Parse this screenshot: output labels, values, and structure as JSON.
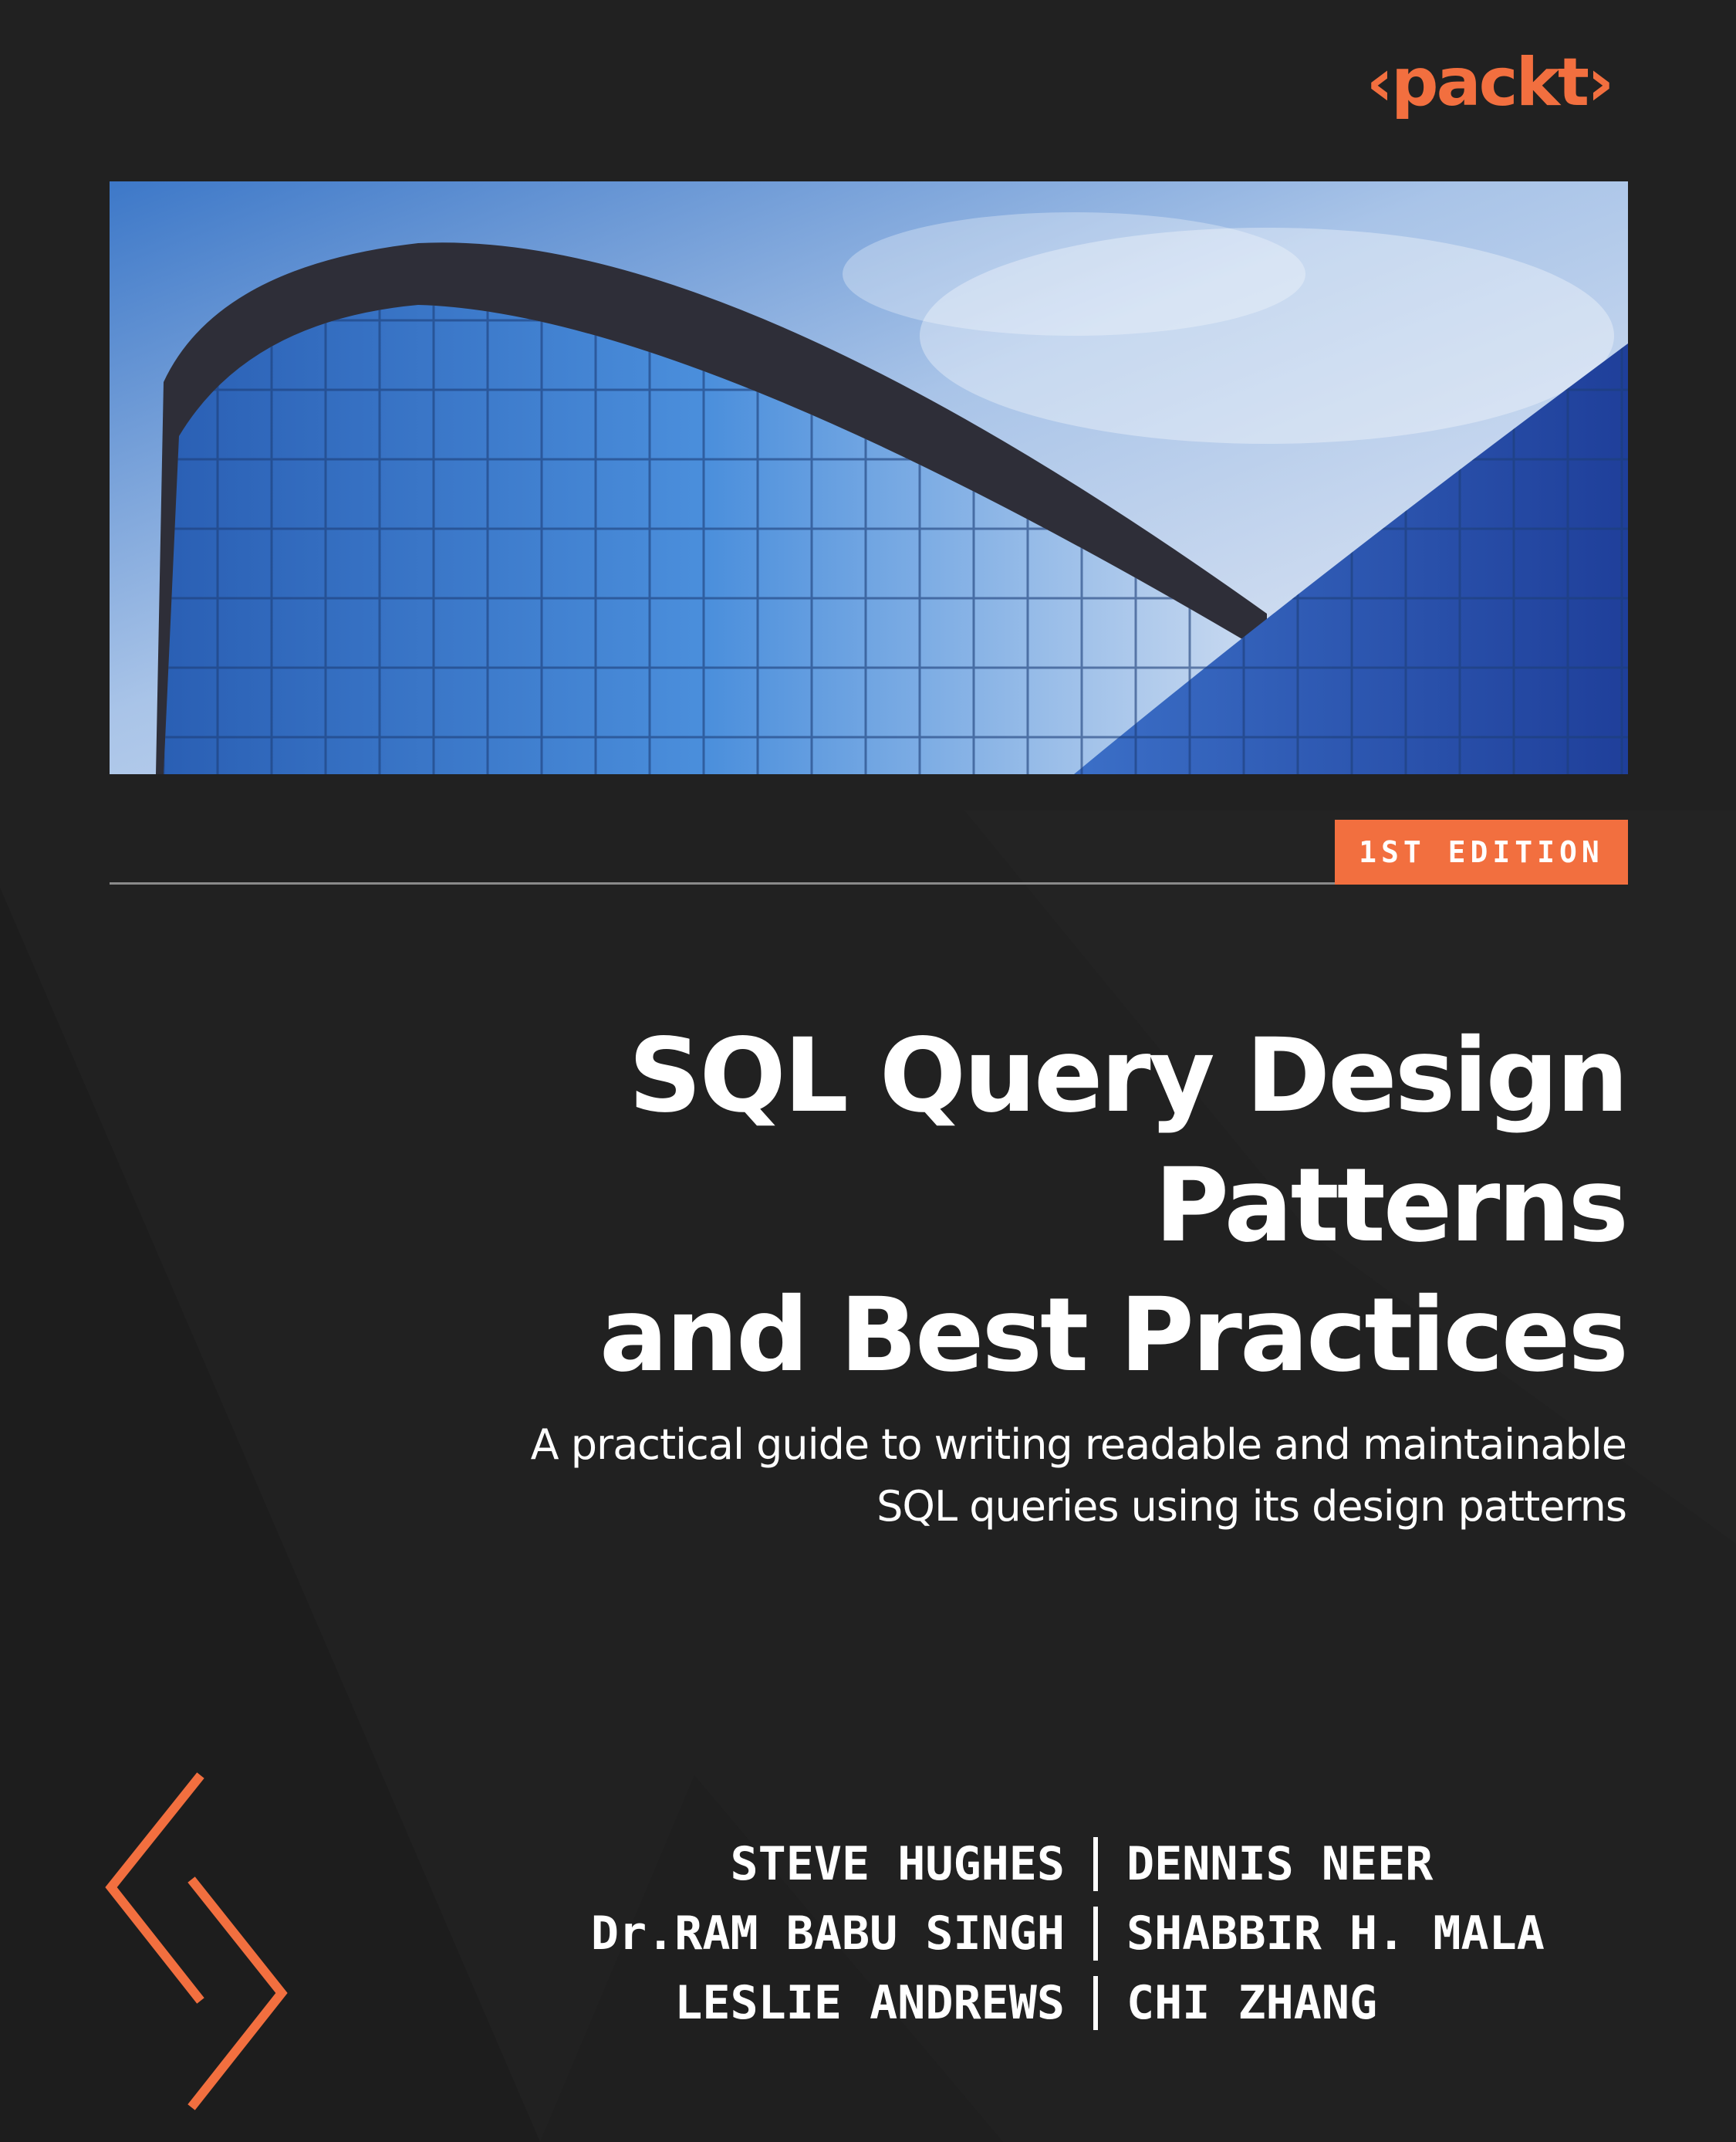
{
  "publisher": {
    "logo_text": "‹packt›",
    "brand_color": "#f26f3f"
  },
  "cover": {
    "hero_image": "glass-office-building-photo",
    "edition_label": "1ST EDITION",
    "title_line1": "SQL Query Design Patterns",
    "title_line2": "and Best Practices",
    "subtitle_line1": "A practical guide to writing readable and maintainable",
    "subtitle_line2": "SQL queries using its design patterns",
    "background_color": "#212121",
    "decor_icon": "code-chevrons-icon"
  },
  "authors": [
    {
      "left": "STEVE HUGHES",
      "right": "DENNIS NEER"
    },
    {
      "left": "Dr.RAM BABU SINGH",
      "right": "SHABBIR H. MALA"
    },
    {
      "left": "LESLIE ANDREWS",
      "right": "CHI ZHANG"
    }
  ]
}
